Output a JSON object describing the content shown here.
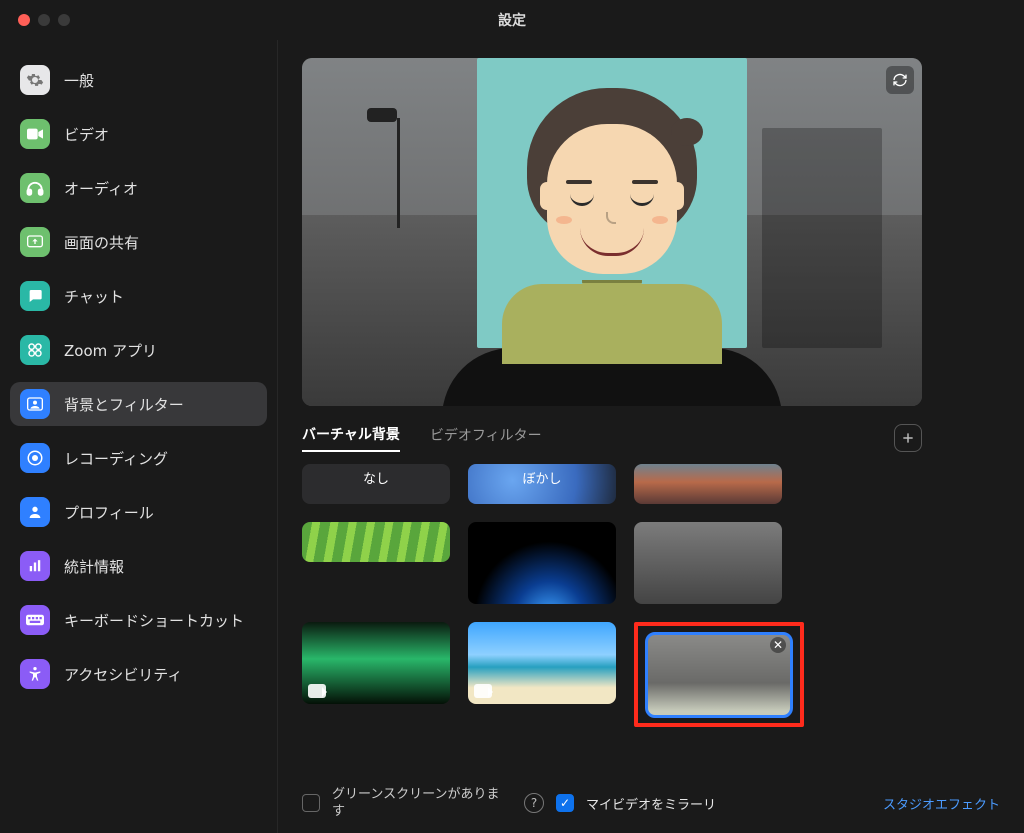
{
  "title": "設定",
  "sidebar": {
    "items": [
      {
        "id": "general",
        "label": "一般"
      },
      {
        "id": "video",
        "label": "ビデオ"
      },
      {
        "id": "audio",
        "label": "オーディオ"
      },
      {
        "id": "share",
        "label": "画面の共有"
      },
      {
        "id": "chat",
        "label": "チャット"
      },
      {
        "id": "apps",
        "label": "Zoom アプリ"
      },
      {
        "id": "bg",
        "label": "背景とフィルター"
      },
      {
        "id": "rec",
        "label": "レコーディング"
      },
      {
        "id": "profile",
        "label": "プロフィール"
      },
      {
        "id": "stats",
        "label": "統計情報"
      },
      {
        "id": "keys",
        "label": "キーボードショートカット"
      },
      {
        "id": "a11y",
        "label": "アクセシビリティ"
      }
    ],
    "active": "bg"
  },
  "tabs": {
    "virtual_bg": "バーチャル背景",
    "video_filter": "ビデオフィルター",
    "active": "virtual_bg"
  },
  "backgrounds": {
    "none": "なし",
    "blur": "ぼかし"
  },
  "footer": {
    "greenscreen_label": "グリーンスクリーンがあります",
    "greenscreen_checked": false,
    "mirror_label": "マイビデオをミラーリ",
    "mirror_checked": true,
    "studio_effects": "スタジオエフェクト"
  }
}
